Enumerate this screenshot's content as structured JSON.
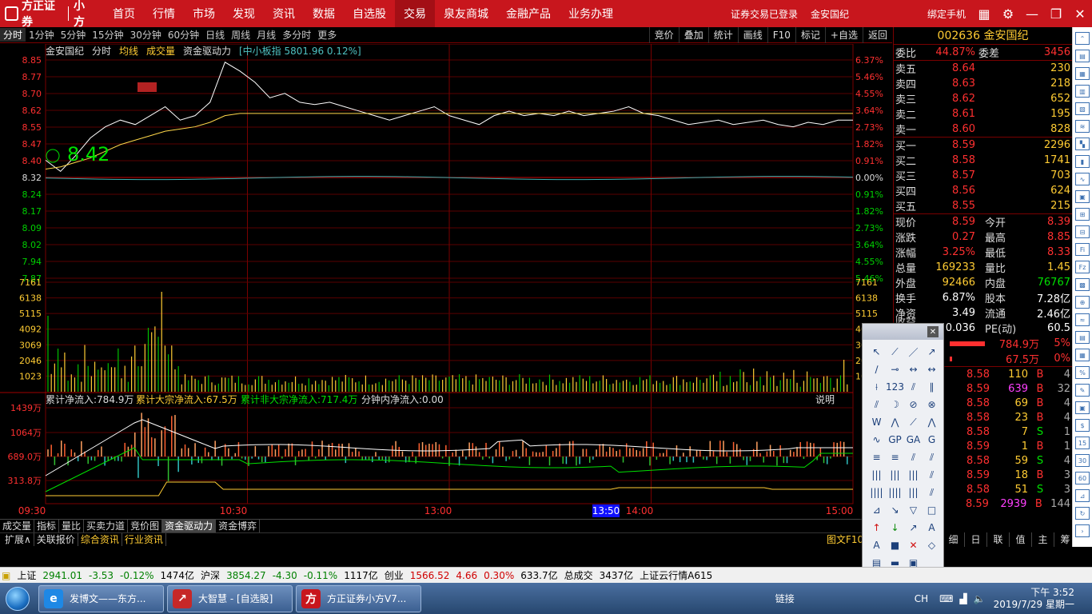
{
  "nav": {
    "logo": "方正证券",
    "logo2": "小方",
    "items": [
      "首页",
      "行情",
      "市场",
      "发现",
      "资讯",
      "数据",
      "自选股",
      "交易",
      "泉友商城",
      "金融产品",
      "业务办理"
    ],
    "active": "交易",
    "login_status": "证券交易已登录",
    "stock_name": "金安国纪",
    "bind_phone": "绑定手机"
  },
  "periods": [
    "分时",
    "1分钟",
    "5分钟",
    "15分钟",
    "30分钟",
    "60分钟",
    "日线",
    "周线",
    "月线",
    "多分时",
    "更多"
  ],
  "right_tools": [
    "竞价",
    "叠加",
    "统计",
    "画线",
    "F10",
    "标记",
    "+自选",
    "返回"
  ],
  "chart_header": {
    "name": "金安国纪",
    "mode": "分时",
    "avg": "均线",
    "vol": "成交量",
    "fund": "资金驱动力",
    "index": "[中小板指 5801.96 0.12%]"
  },
  "price_labels": [
    "8.85",
    "8.77",
    "8.70",
    "8.62",
    "8.55",
    "8.47",
    "8.40",
    "8.32",
    "8.24",
    "8.17",
    "8.09",
    "8.02",
    "7.94",
    "7.87"
  ],
  "pct_labels": [
    "6.37%",
    "5.46%",
    "4.55%",
    "3.64%",
    "2.73%",
    "1.82%",
    "0.91%",
    "0.00%",
    "0.91%",
    "1.82%",
    "2.73%",
    "3.64%",
    "4.55%",
    "5.46%"
  ],
  "vol_labels": [
    "7161",
    "6138",
    "5115",
    "4092",
    "3069",
    "2046",
    "1023"
  ],
  "big_price": "8.42",
  "fund_header": {
    "total": "累计净流入:784.9万",
    "big": "累计大宗净流入:67.5万",
    "nonbig": "累计非大宗净流入:717.4万",
    "minute": "分钟内净流入:0.00",
    "explain": "说明"
  },
  "fund_labels": [
    "1439万",
    "1064万",
    "689.0万",
    "313.8万"
  ],
  "time_labels": [
    "09:30",
    "10:30",
    "13:00",
    "14:00",
    "15:00"
  ],
  "cursor_time": "13:50",
  "chart_data": {
    "type": "line",
    "title": "金安国纪 分时",
    "ylim": [
      7.79,
      8.85
    ],
    "prev_close": 8.32,
    "series": [
      {
        "name": "分时",
        "values": [
          8.4,
          8.35,
          8.42,
          8.5,
          8.55,
          8.58,
          8.56,
          8.6,
          8.64,
          8.58,
          8.6,
          8.66,
          8.84,
          8.8,
          8.75,
          8.68,
          8.7,
          8.66,
          8.65,
          8.66,
          8.64,
          8.62,
          8.6,
          8.58,
          8.6,
          8.62,
          8.64,
          8.6,
          8.58,
          8.56,
          8.6,
          8.62,
          8.6,
          8.61,
          8.6,
          8.62,
          8.6,
          8.61,
          8.62,
          8.64,
          8.61,
          8.6,
          8.58,
          8.56,
          8.57,
          8.58,
          8.56,
          8.57,
          8.58,
          8.56,
          8.55,
          8.57,
          8.56,
          8.58,
          8.58
        ]
      },
      {
        "name": "均线",
        "values": [
          8.36,
          8.37,
          8.39,
          8.41,
          8.44,
          8.47,
          8.49,
          8.51,
          8.53,
          8.54,
          8.55,
          8.57,
          8.6,
          8.61,
          8.61,
          8.61,
          8.61,
          8.61,
          8.61,
          8.61,
          8.61,
          8.61,
          8.61,
          8.61,
          8.61,
          8.61,
          8.61,
          8.61,
          8.61,
          8.61,
          8.61,
          8.61,
          8.61,
          8.61,
          8.61,
          8.61,
          8.61,
          8.61,
          8.61,
          8.61,
          8.61,
          8.61,
          8.61,
          8.61,
          8.61,
          8.61,
          8.61,
          8.61,
          8.61,
          8.61,
          8.61,
          8.61,
          8.61,
          8.61,
          8.61
        ]
      }
    ]
  },
  "panel": {
    "code": "002636",
    "name": "金安国纪",
    "weibi": {
      "label": "委比",
      "value": "44.87%",
      "label2": "委差",
      "value2": "3456"
    },
    "sells": [
      {
        "l": "卖五",
        "p": "8.64",
        "v": "230"
      },
      {
        "l": "卖四",
        "p": "8.63",
        "v": "218"
      },
      {
        "l": "卖三",
        "p": "8.62",
        "v": "652"
      },
      {
        "l": "卖二",
        "p": "8.61",
        "v": "195"
      },
      {
        "l": "卖一",
        "p": "8.60",
        "v": "828"
      }
    ],
    "buys": [
      {
        "l": "买一",
        "p": "8.59",
        "v": "2296"
      },
      {
        "l": "买二",
        "p": "8.58",
        "v": "1741"
      },
      {
        "l": "买三",
        "p": "8.57",
        "v": "703"
      },
      {
        "l": "买四",
        "p": "8.56",
        "v": "624"
      },
      {
        "l": "买五",
        "p": "8.55",
        "v": "215"
      }
    ],
    "quotes": [
      {
        "a": "现价",
        "b": "8.59",
        "c": "今开",
        "d": "8.39"
      },
      {
        "a": "涨跌",
        "b": "0.27",
        "c": "最高",
        "d": "8.85"
      },
      {
        "a": "涨幅",
        "b": "3.25%",
        "c": "最低",
        "d": "8.33"
      },
      {
        "a": "总量",
        "b": "169233",
        "c": "量比",
        "d": "1.45"
      },
      {
        "a": "外盘",
        "b": "92466",
        "c": "内盘",
        "d": "76767"
      },
      {
        "a": "换手",
        "b": "6.87%",
        "c": "股本",
        "d": "7.28亿"
      },
      {
        "a": "净资",
        "b": "3.49",
        "c": "流通",
        "d": "2.46亿"
      },
      {
        "a": "收益(一)",
        "b": "0.036",
        "c": "PE(动)",
        "d": "60.5"
      }
    ],
    "flows": [
      {
        "v": "784.9万",
        "p": "5%"
      },
      {
        "v": "67.5万",
        "p": "0%"
      }
    ],
    "trades": [
      {
        "p": "8.58",
        "v": "110",
        "s": "B",
        "n": "4"
      },
      {
        "p": "8.59",
        "v": "639",
        "s": "B",
        "n": "32"
      },
      {
        "p": "8.58",
        "v": "69",
        "s": "B",
        "n": "4"
      },
      {
        "p": "8.58",
        "v": "23",
        "s": "B",
        "n": "4"
      },
      {
        "p": "8.58",
        "v": "7",
        "s": "S",
        "n": "1"
      },
      {
        "p": "8.59",
        "v": "1",
        "s": "B",
        "n": "1"
      },
      {
        "p": "8.58",
        "v": "59",
        "s": "S",
        "n": "4"
      },
      {
        "p": "8.59",
        "v": "18",
        "s": "B",
        "n": "3"
      },
      {
        "p": "8.58",
        "v": "51",
        "s": "S",
        "n": "3"
      },
      {
        "p": "8.59",
        "v": "2939",
        "s": "B",
        "n": "144"
      }
    ],
    "tabs": [
      "细",
      "日",
      "联",
      "值",
      "主",
      "筹"
    ]
  },
  "tabs1": [
    "成交量",
    "指标",
    "量比",
    "买卖力道",
    "竞价图",
    "资金驱动力",
    "资金博弈"
  ],
  "tabs1_active": "资金驱动力",
  "tabs2": [
    "扩展∧",
    "关联报价",
    "综合资讯",
    "行业资讯"
  ],
  "tuwen": "图文F10 仅",
  "status": {
    "sh": "上证",
    "sh_v": "2941.01",
    "sh_c": "-3.53",
    "sh_p": "-0.12%",
    "sh_a": "1474亿",
    "sz": "沪深",
    "sz_v": "3854.27",
    "sz_c": "-4.30",
    "sz_p": "-0.11%",
    "sz_a": "1117亿",
    "cy": "创业",
    "cy_v": "1566.52",
    "cy_c": "4.66",
    "cy_p": "0.30%",
    "cy_a": "633.7亿",
    "tot": "总成交",
    "tot_v": "3437亿",
    "cloud": "上证云行情A615"
  },
  "taskbar": {
    "t1": "发博文——东方...",
    "t2": "大智慧 - [自选股]",
    "t3": "方正证券小方V7...",
    "link": "链接",
    "ime": "CH",
    "time": "下午 3:52",
    "date": "2019/7/29 星期一"
  }
}
